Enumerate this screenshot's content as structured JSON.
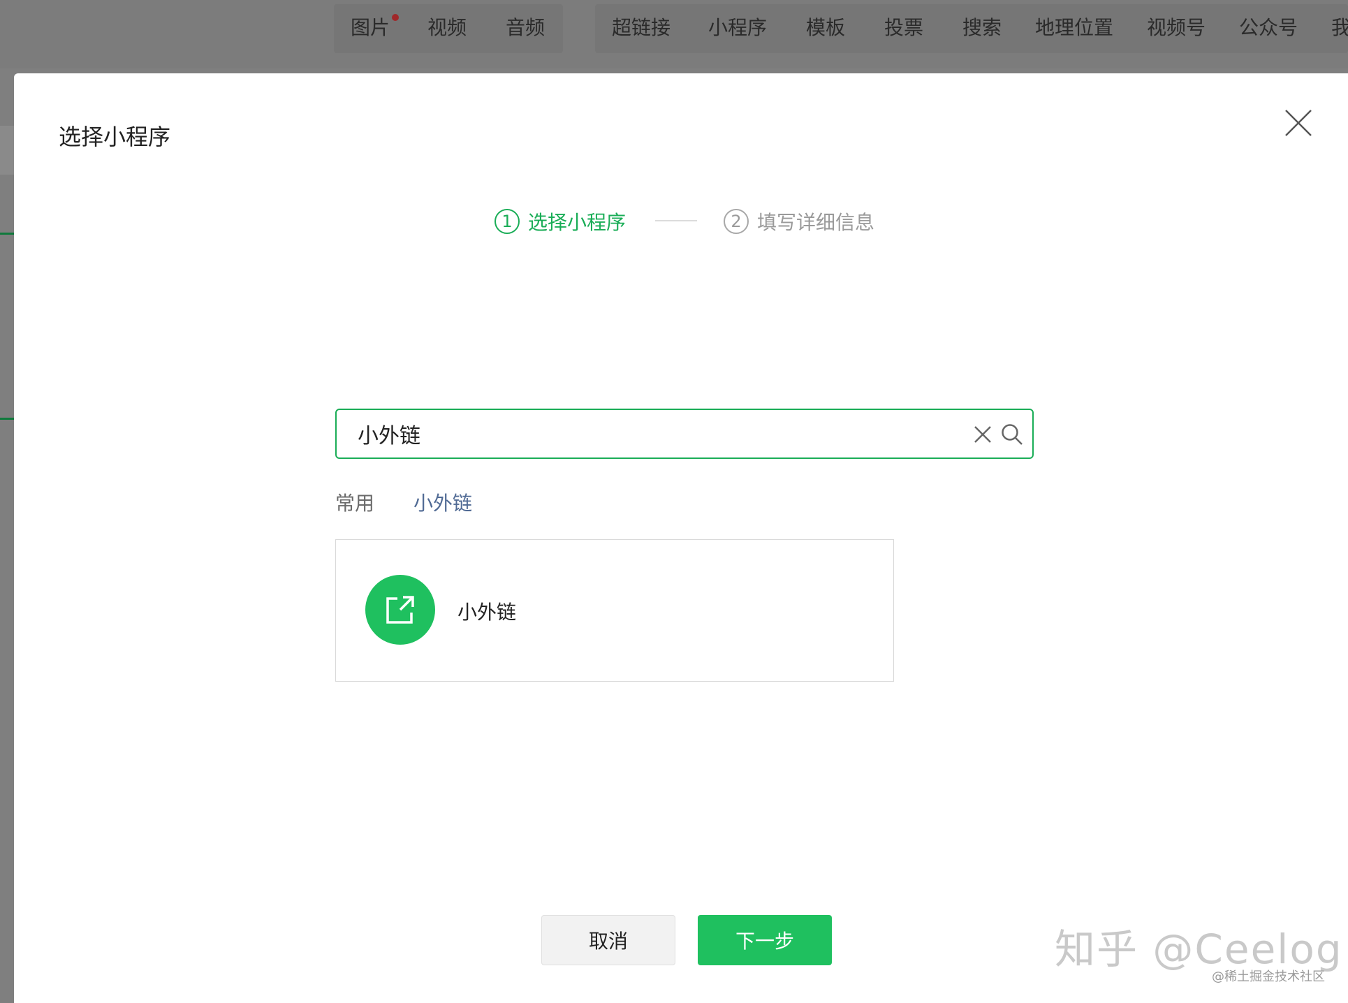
{
  "toolbar": {
    "group1": [
      {
        "label": "图片",
        "has_dot": true
      },
      {
        "label": "视频"
      },
      {
        "label": "音频"
      }
    ],
    "group2": [
      {
        "label": "超链接"
      },
      {
        "label": "小程序"
      },
      {
        "label": "模板"
      },
      {
        "label": "投票"
      },
      {
        "label": "搜索"
      },
      {
        "label": "地理位置"
      },
      {
        "label": "视频号"
      },
      {
        "label": "公众号"
      },
      {
        "label": "我"
      }
    ]
  },
  "dialog": {
    "title": "选择小程序",
    "steps": [
      {
        "number": "1",
        "label": "选择小程序",
        "state": "active"
      },
      {
        "number": "2",
        "label": "填写详细信息",
        "state": "inactive"
      }
    ],
    "search": {
      "value": "小外链"
    },
    "tabs": [
      {
        "label": "常用"
      },
      {
        "label": "小外链"
      }
    ],
    "results": [
      {
        "name": "小外链",
        "icon": "external-link-icon"
      }
    ],
    "buttons": {
      "cancel": "取消",
      "next": "下一步"
    }
  },
  "watermark": {
    "main": "知乎 @Ceelog",
    "small": "@稀土掘金技术社区"
  },
  "colors": {
    "accent": "#1aad57",
    "button_green": "#1fc05f",
    "overlay": "#7f7f7f"
  }
}
